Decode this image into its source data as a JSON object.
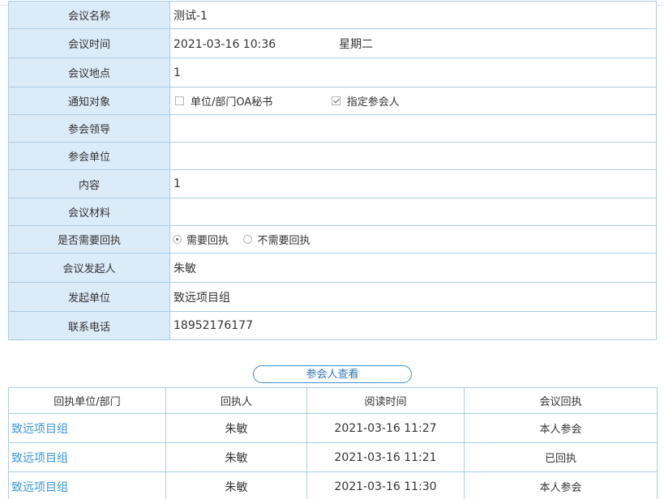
{
  "info_rows": {
    "meeting_name": {
      "label": "会议名称",
      "value": "测试-1"
    },
    "meeting_time": {
      "label": "会议时间",
      "value": "2021-03-16 10:36",
      "weekday": "星期二"
    },
    "meeting_place": {
      "label": "会议地点",
      "value": "1"
    },
    "notify_target": {
      "label": "通知对象",
      "options": [
        {
          "label": "单位/部门OA秘书",
          "checked": false
        },
        {
          "label": "指定参会人",
          "checked": true
        }
      ]
    },
    "leaders": {
      "label": "参会领导",
      "value": ""
    },
    "units": {
      "label": "参会单位",
      "value": ""
    },
    "content": {
      "label": "内容",
      "value": "1"
    },
    "materials": {
      "label": "会议材料",
      "value": ""
    },
    "need_reply": {
      "label": "是否需要回执",
      "options": [
        {
          "label": "需要回执",
          "selected": true
        },
        {
          "label": "不需要回执",
          "selected": false
        }
      ]
    },
    "initiator": {
      "label": "会议发起人",
      "value": "朱敏"
    },
    "initiator_unit": {
      "label": "发起单位",
      "value": "致远项目组"
    },
    "phone": {
      "label": "联系电话",
      "value": "18952176177"
    }
  },
  "view_button": {
    "label": "参会人查看"
  },
  "receipt_table": {
    "headers": [
      "回执单位/部门",
      "回执人",
      "阅读时间",
      "会议回执"
    ],
    "rows": [
      [
        "致远项目组",
        "朱敏",
        "2021-03-16 11:27",
        "本人参会"
      ],
      [
        "致远项目组",
        "朱敏",
        "2021-03-16 11:21",
        "已回执"
      ],
      [
        "致远项目组",
        "朱敏",
        "2021-03-16 11:30",
        "本人参会"
      ]
    ]
  },
  "colors": {
    "label_bg": "#dcebf8",
    "border": "#a9cde5",
    "link": "#3a97d6",
    "button_border": "#3f8fd0"
  }
}
